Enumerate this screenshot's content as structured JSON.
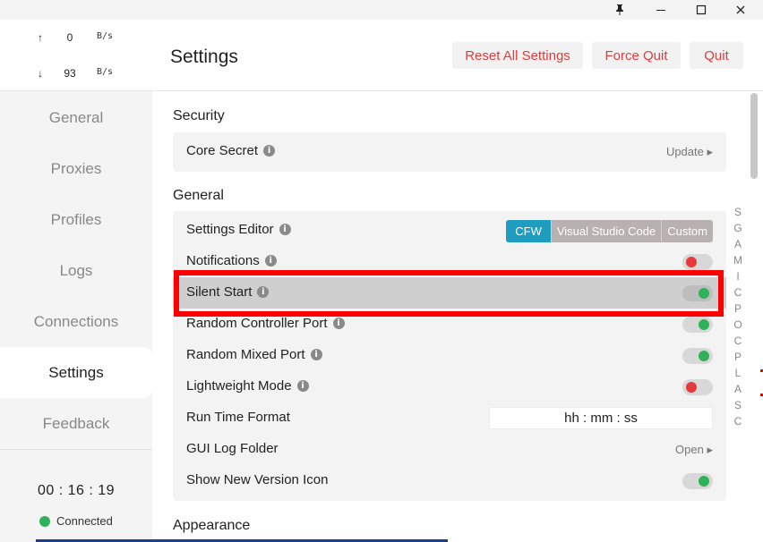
{
  "titlebar": {
    "pin_icon": "pin-icon",
    "minimize_icon": "minimize-icon",
    "maximize_icon": "maximize-icon",
    "close_icon": "close-icon",
    "pin_glyph": "📌",
    "minimize_glyph": "–",
    "maximize_glyph": "☐",
    "close_glyph": "✕"
  },
  "traffic": {
    "up_arrow": "↑",
    "up_value": "0",
    "up_unit": "B/s",
    "down_arrow": "↓",
    "down_value": "93",
    "down_unit": "B/s"
  },
  "sidebar": {
    "items": [
      {
        "label": "General"
      },
      {
        "label": "Proxies"
      },
      {
        "label": "Profiles"
      },
      {
        "label": "Logs"
      },
      {
        "label": "Connections"
      },
      {
        "label": "Settings",
        "active": true
      },
      {
        "label": "Feedback"
      }
    ],
    "timer": "00 : 16 : 19",
    "status": "Connected",
    "status_color": "#2fb159"
  },
  "header": {
    "title": "Settings",
    "reset_label": "Reset All Settings",
    "force_quit_label": "Force Quit",
    "quit_label": "Quit",
    "button_text_color": "#e53a3a"
  },
  "security": {
    "title": "Security",
    "core_secret_label": "Core Secret",
    "core_secret_action": "Update ▸"
  },
  "general": {
    "title": "General",
    "settings_editor_label": "Settings Editor",
    "editor_options": [
      "CFW",
      "Visual Studio Code",
      "Custom"
    ],
    "editor_selected": "CFW",
    "notifications_label": "Notifications",
    "notifications_on": false,
    "silent_start_label": "Silent Start",
    "silent_start_on": true,
    "random_controller_port_label": "Random Controller Port",
    "random_controller_port_on": true,
    "random_mixed_port_label": "Random Mixed Port",
    "random_mixed_port_on": true,
    "lightweight_mode_label": "Lightweight Mode",
    "lightweight_mode_on": false,
    "run_time_format_label": "Run Time Format",
    "run_time_format_value": "hh : mm : ss",
    "gui_log_folder_label": "GUI Log Folder",
    "gui_log_folder_action": "Open ▸",
    "show_new_version_icon_label": "Show New Version Icon",
    "show_new_version_icon_on": true
  },
  "appearance": {
    "title": "Appearance"
  },
  "index_letters": [
    "S",
    "G",
    "A",
    "M",
    "I",
    "C",
    "P",
    "O",
    "C",
    "P",
    "L",
    "A",
    "S",
    "C"
  ],
  "info_glyph": "i",
  "accent_color": "#1e9dc0"
}
